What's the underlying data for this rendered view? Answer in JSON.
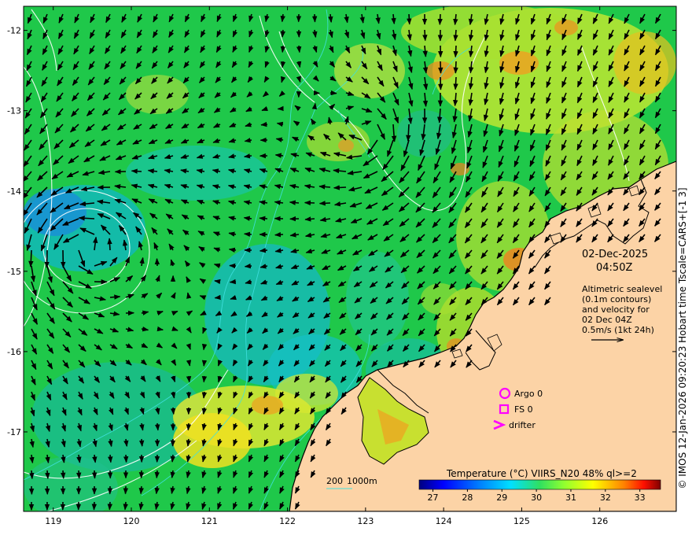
{
  "map": {
    "lon_ticks": [
      "119",
      "120",
      "121",
      "122",
      "123",
      "124",
      "125",
      "126"
    ],
    "lat_ticks": [
      "-12",
      "-13",
      "-14",
      "-15",
      "-16",
      "-17"
    ],
    "lon_range": [
      118.62,
      126.98
    ],
    "lat_range": [
      -17.99,
      -11.7
    ]
  },
  "annotation": {
    "date": "02-Dec-2025",
    "time": "04:50Z",
    "description_lines": [
      "Altimetric sealevel",
      "(0.1m contours)",
      "and velocity for",
      "02 Dec 04Z",
      "0.5m/s (1kt 24h)"
    ]
  },
  "legend": {
    "argo": "Argo 0",
    "fs": "FS 0",
    "drifter": "drifter",
    "argo_color": "#ff00ff",
    "fs_color": "#ff00ff",
    "drifter_color": "#ff00ff"
  },
  "bathymetry": {
    "label_200": "200",
    "label_1000": "1000m",
    "contour_color": "#40e0e0"
  },
  "colorbar": {
    "title": "Temperature (°C) VIIRS_N20 48% ql>=2",
    "ticks": [
      "27",
      "28",
      "29",
      "30",
      "31",
      "32",
      "33"
    ],
    "range": [
      26.6,
      33.6
    ],
    "colors": [
      "#00007f",
      "#0000ff",
      "#007fff",
      "#00ffff",
      "#40ff80",
      "#80ff40",
      "#ffff00",
      "#ff8000",
      "#ff0000",
      "#7f0000"
    ]
  },
  "credit": "© IMOS 12-Jan-2026 09:20:23 Hobart time Tscale=CARS+[-1 3]",
  "colors": {
    "land": "#fcd3a6",
    "ocean_base": "#1fc84a",
    "coast": "#000000",
    "sealevel_contour": "#ffffff",
    "vector": "#000000"
  }
}
